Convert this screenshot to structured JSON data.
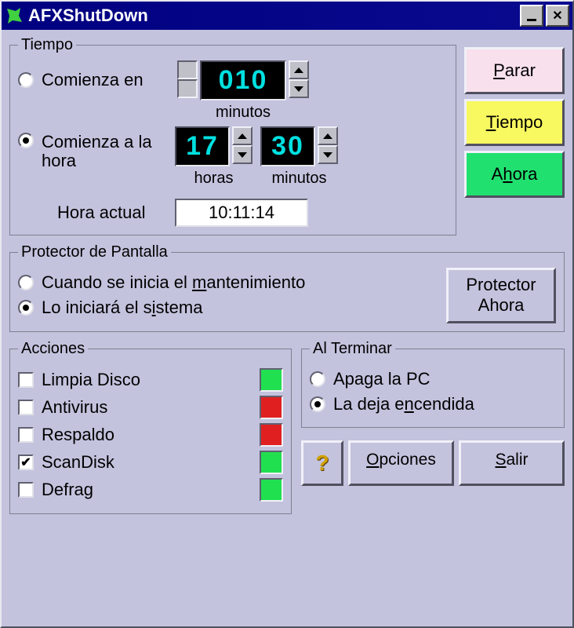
{
  "window_title": "AFXShutDown",
  "tiempo": {
    "legend": "Tiempo",
    "comienza_en": "Comienza en",
    "comienza_en_value": "010",
    "comienza_en_minutos": "minutos",
    "comienza_hora": "Comienza a la hora",
    "horas_value": "17",
    "minutos_value": "30",
    "horas_label": "horas",
    "minutos_label": "minutos",
    "hora_actual_label": "Hora actual",
    "hora_actual_value": "10:11:14",
    "selected": "comienza_hora"
  },
  "side_buttons": {
    "parar": "Parar",
    "tiempo": "Tiempo",
    "ahora": "Ahora"
  },
  "protector": {
    "legend": "Protector de Pantalla",
    "opt1": "Cuando se inicia el mantenimiento",
    "opt2": "Lo iniciará el sistema",
    "selected": "opt2",
    "button": "Protector Ahora"
  },
  "acciones": {
    "legend": "Acciones",
    "items": [
      {
        "label": "Limpia Disco",
        "checked": false,
        "status": "green"
      },
      {
        "label": "Antivirus",
        "checked": false,
        "status": "red"
      },
      {
        "label": "Respaldo",
        "checked": false,
        "status": "red"
      },
      {
        "label": "ScanDisk",
        "checked": true,
        "status": "green"
      },
      {
        "label": "Defrag",
        "checked": false,
        "status": "green"
      }
    ]
  },
  "terminar": {
    "legend": "Al Terminar",
    "opt1": "Apaga la PC",
    "opt2": "La deja encendida",
    "selected": "opt2"
  },
  "footer": {
    "opciones": "Opciones",
    "salir": "Salir"
  }
}
